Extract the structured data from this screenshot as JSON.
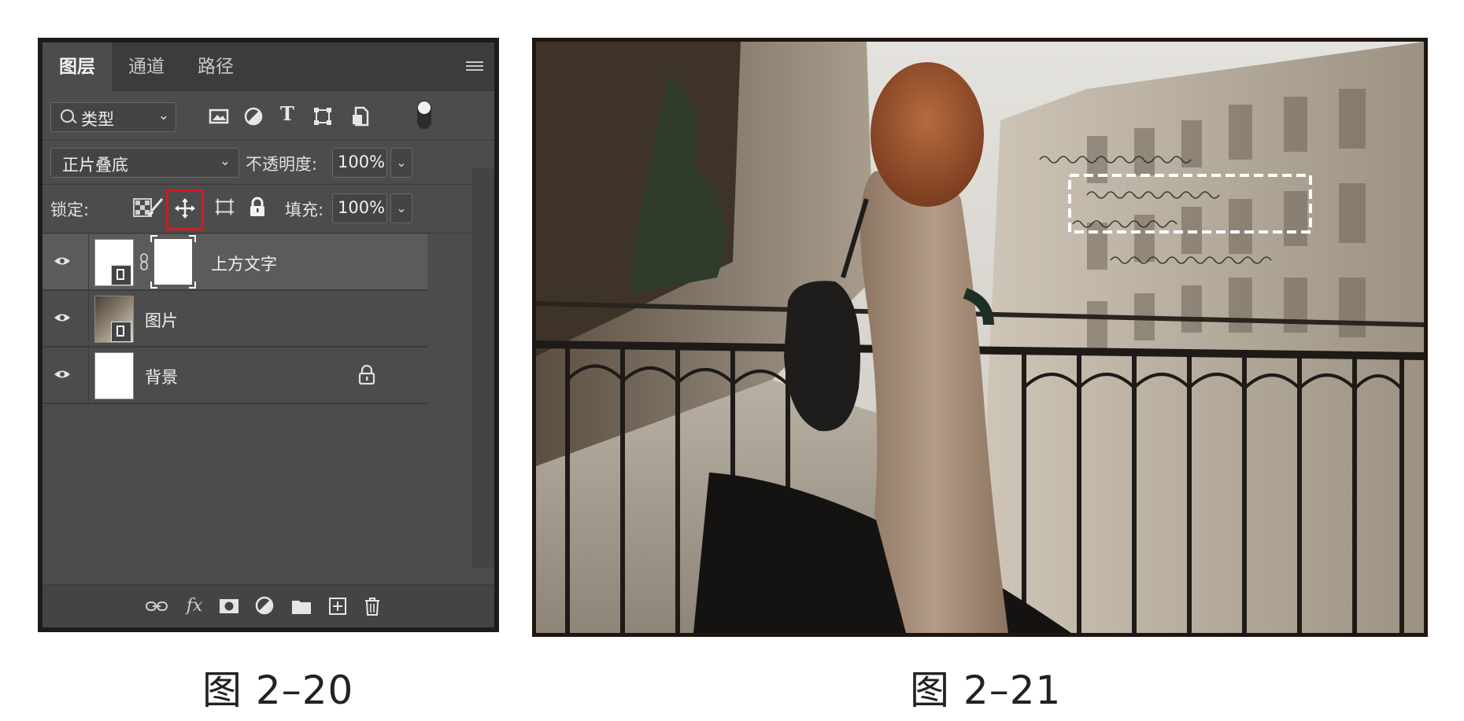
{
  "layers_panel": {
    "tabs": [
      "图层",
      "通道",
      "路径"
    ],
    "active_tab": "图层",
    "filter": {
      "label": "类型"
    },
    "blend_mode": "正片叠底",
    "opacity_label": "不透明度:",
    "opacity_value": "100%",
    "lock_label": "锁定:",
    "fill_label": "填充:",
    "fill_value": "100%",
    "highlighted_lock": "lock-position-icon",
    "layers": [
      {
        "name": "上方文字",
        "visible": true,
        "selected": true,
        "has_mask": true
      },
      {
        "name": "图片",
        "visible": true,
        "selected": false,
        "has_mask": false
      },
      {
        "name": "背景",
        "visible": true,
        "selected": false,
        "locked": true
      }
    ]
  },
  "photo": {
    "handwritten_lines": [
      "誰的眼神曾那麼清澈",
      "誰為誰唱起黑色旋歌",
      "在很多很多年以後",
      "我還記得那些 clean clean heart"
    ]
  },
  "captions": {
    "left": "图 2–20",
    "right": "图 2–21"
  },
  "colors": {
    "highlight_red": "#d11a22",
    "panel_bg": "#4c4c4c"
  }
}
